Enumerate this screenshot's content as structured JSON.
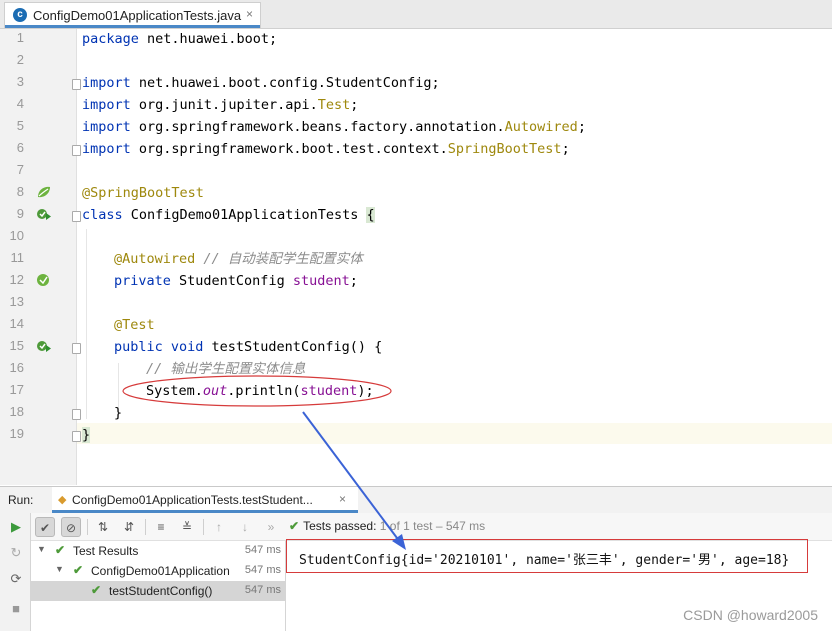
{
  "tab": {
    "title": "ConfigDemo01ApplicationTests.java",
    "close": "×",
    "icon": "java-class-icon"
  },
  "editor": {
    "line_numbers": [
      "1",
      "2",
      "3",
      "4",
      "5",
      "6",
      "7",
      "8",
      "9",
      "10",
      "11",
      "12",
      "13",
      "14",
      "15",
      "16",
      "17",
      "18",
      "19"
    ],
    "code": {
      "l1_kw": "package",
      "l1_rest": " net.huawei.boot;",
      "l3_kw": "import",
      "l3_rest": " net.huawei.boot.config.StudentConfig;",
      "l4_kw": "import",
      "l4_rest": " org.junit.jupiter.api.",
      "l4_cls": "Test",
      "l4_end": ";",
      "l5_kw": "import",
      "l5_rest": " org.springframework.beans.factory.annotation.",
      "l5_cls": "Autowired",
      "l5_end": ";",
      "l6_kw": "import",
      "l6_rest": " org.springframework.boot.test.context.",
      "l6_cls": "SpringBootTest",
      "l6_end": ";",
      "l8_ann": "@SpringBootTest",
      "l9_kw": "class",
      "l9_rest": " ConfigDemo01ApplicationTests ",
      "l9_brace": "{",
      "l11_ann": "@Autowired",
      "l11_cmt": " // 自动装配学生配置实体",
      "l12_kw": "private",
      "l12_rest": " StudentConfig ",
      "l12_fld": "student",
      "l12_end": ";",
      "l14_ann": "@Test",
      "l15_kw": "public void",
      "l15_rest": " testStudentConfig() {",
      "l16_cmt": "// 输出学生配置实体信息",
      "l17_a": "System.",
      "l17_out": "out",
      "l17_b": ".println(",
      "l17_fld": "student",
      "l17_c": ");",
      "l18": "}",
      "l19": "}"
    }
  },
  "run": {
    "label": "Run:",
    "tab_label": "ConfigDemo01ApplicationTests.testStudent...",
    "tab_close": "×",
    "status_passed": "Tests passed:",
    "status_meta": "1 of 1 test – 547 ms",
    "tree": [
      {
        "name": "Test Results",
        "time": "547 ms"
      },
      {
        "name": "ConfigDemo01Application",
        "time": "547 ms"
      },
      {
        "name": "testStudentConfig()",
        "time": "547 ms"
      }
    ],
    "output": "StudentConfig{id='20210101', name='张三丰', gender='男', age=18}"
  },
  "watermark": "CSDN @howard2005",
  "colors": {
    "keyword": "#0033b3",
    "annotation": "#9e880d",
    "comment": "#8c8c8c",
    "field": "#871094",
    "pass": "#4e9a3a",
    "highlight": "#d63b3b",
    "arrow": "#3b63d6"
  }
}
